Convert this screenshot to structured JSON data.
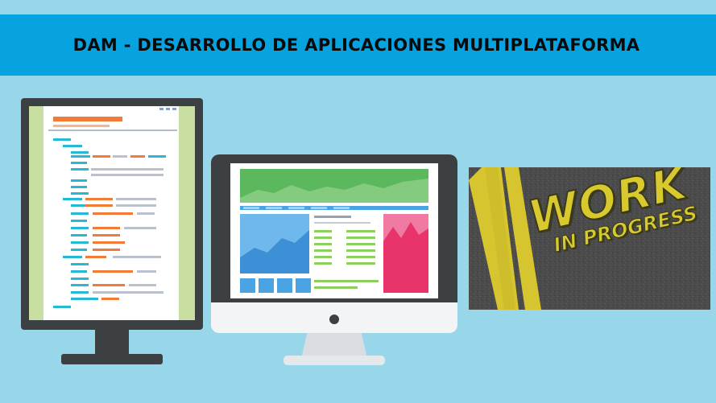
{
  "banner": {
    "title": "DAM - DESARROLLO DE APLICACIONES MULTIPLATAFORMA"
  },
  "wip_sign": {
    "line1": "WORK",
    "line2": "IN PROGRESS"
  },
  "colors": {
    "background": "#98d6e9",
    "banner": "#06a3e0",
    "monitor_frame": "#3c4043",
    "code_orange": "#f47b36",
    "code_cyan": "#26b9d6",
    "chart_green": "#5cb85c",
    "chart_blue": "#4aa3e2",
    "chart_pink": "#e8346b",
    "asphalt": "#4b4b4b",
    "road_line": "#d6c52f"
  }
}
